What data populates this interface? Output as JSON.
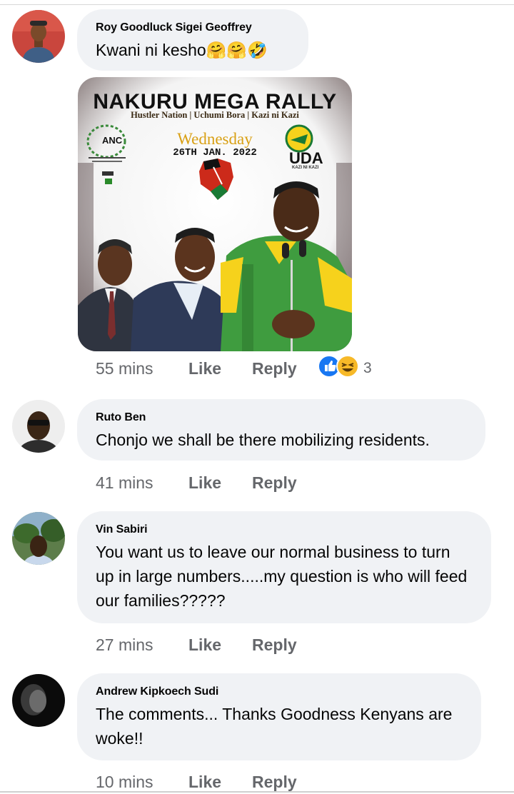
{
  "comments": [
    {
      "author": "Roy Goodluck Sigei Geoffrey",
      "text": "Kwani ni kesho🤗🤗🤣",
      "time": "55 mins",
      "like": "Like",
      "reply": "Reply",
      "reaction_count": "3",
      "reactions": [
        "like-icon",
        "laugh-emoji-icon"
      ],
      "attachment": {
        "title": "NAKURU MEGA RALLY",
        "subtitle": "Hustler Nation | Uchumi Bora | Kazi ni Kazi",
        "day": "Wednesday",
        "date": "26TH JAN. 2022",
        "left_logo": "ANC",
        "right_logo": "UDA",
        "right_slogan": "KAZI NI KAZI"
      }
    },
    {
      "author": "Ruto Ben",
      "text": "Chonjo we shall be there mobilizing residents.",
      "time": "41 mins",
      "like": "Like",
      "reply": "Reply"
    },
    {
      "author": "Vin Sabiri",
      "text": "You want us to leave our normal business to turn up in large numbers.....my question is who will feed our families?????",
      "time": "27 mins",
      "like": "Like",
      "reply": "Reply"
    },
    {
      "author": "Andrew Kipkoech Sudi",
      "text": "The comments... Thanks Goodness Kenyans are woke!!",
      "time": "10 mins",
      "like": "Like",
      "reply": "Reply"
    }
  ],
  "colors": {
    "bubble": "#f0f2f5",
    "meta_text": "#65676b",
    "like_blue": "#1877f2",
    "haha_yellow": "#f7b928",
    "uda_yellow": "#f6d21c",
    "uda_green": "#1a7a35"
  }
}
